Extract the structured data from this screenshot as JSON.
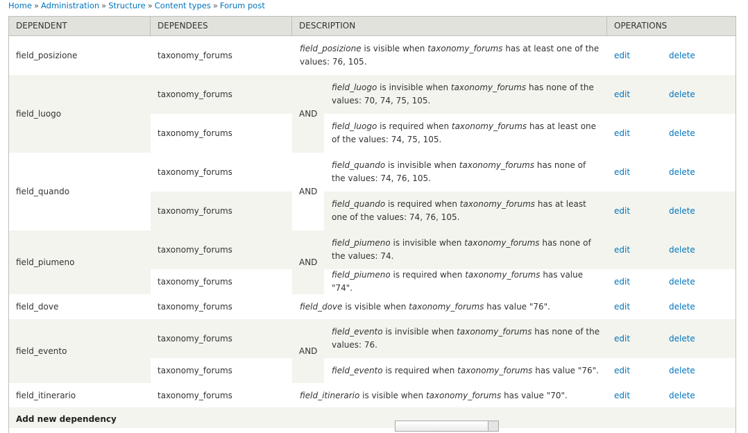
{
  "breadcrumb": {
    "items": [
      "Home",
      "Administration",
      "Structure",
      "Content types",
      "Forum post"
    ],
    "separator": "»"
  },
  "table": {
    "headers": {
      "dependent": "DEPENDENT",
      "dependees": "DEPENDEES",
      "description": "DESCRIPTION",
      "operations": "OPERATIONS"
    },
    "and_label": "AND",
    "edit_label": "edit",
    "delete_label": "delete",
    "groups": [
      {
        "dependent": "field_posizione",
        "rules": [
          {
            "dependee": "taxonomy_forums",
            "field": "field_posizione",
            "mid": " is visible when ",
            "dependee_italic": "taxonomy_forums",
            "tail": " has at least one of the values: 76, 105."
          }
        ]
      },
      {
        "dependent": "field_luogo",
        "rules": [
          {
            "dependee": "taxonomy_forums",
            "field": "field_luogo",
            "mid": " is invisible when ",
            "dependee_italic": "taxonomy_forums",
            "tail": " has none of the values: 70, 74, 75, 105."
          },
          {
            "dependee": "taxonomy_forums",
            "field": "field_luogo",
            "mid": " is required when ",
            "dependee_italic": "taxonomy_forums",
            "tail": " has at least one of the values: 74, 75, 105."
          }
        ]
      },
      {
        "dependent": "field_quando",
        "rules": [
          {
            "dependee": "taxonomy_forums",
            "field": "field_quando",
            "mid": " is invisible when ",
            "dependee_italic": "taxonomy_forums",
            "tail": " has none of the values: 74, 76, 105."
          },
          {
            "dependee": "taxonomy_forums",
            "field": "field_quando",
            "mid": " is required when ",
            "dependee_italic": "taxonomy_forums",
            "tail": " has at least one of the values: 74, 76, 105."
          }
        ]
      },
      {
        "dependent": "field_piumeno",
        "rules": [
          {
            "dependee": "taxonomy_forums",
            "field": "field_piumeno",
            "mid": " is invisible when ",
            "dependee_italic": "taxonomy_forums",
            "tail": " has none of the values: 74."
          },
          {
            "dependee": "taxonomy_forums",
            "field": "field_piumeno",
            "mid": " is required when ",
            "dependee_italic": "taxonomy_forums",
            "tail": " has value \"74\"."
          }
        ]
      },
      {
        "dependent": "field_dove",
        "rules": [
          {
            "dependee": "taxonomy_forums",
            "field": "field_dove",
            "mid": " is visible when ",
            "dependee_italic": "taxonomy_forums",
            "tail": " has value \"76\"."
          }
        ]
      },
      {
        "dependent": "field_evento",
        "rules": [
          {
            "dependee": "taxonomy_forums",
            "field": "field_evento",
            "mid": " is invisible when ",
            "dependee_italic": "taxonomy_forums",
            "tail": " has none of the values: 76."
          },
          {
            "dependee": "taxonomy_forums",
            "field": "field_evento",
            "mid": " is required when ",
            "dependee_italic": "taxonomy_forums",
            "tail": " has value \"76\"."
          }
        ]
      },
      {
        "dependent": "field_itinerario",
        "rules": [
          {
            "dependee": "taxonomy_forums",
            "field": "field_itinerario",
            "mid": " is visible when ",
            "dependee_italic": "taxonomy_forums",
            "tail": " has value \"70\"."
          }
        ]
      }
    ]
  },
  "add_dependency": {
    "title": "Add new dependency"
  }
}
